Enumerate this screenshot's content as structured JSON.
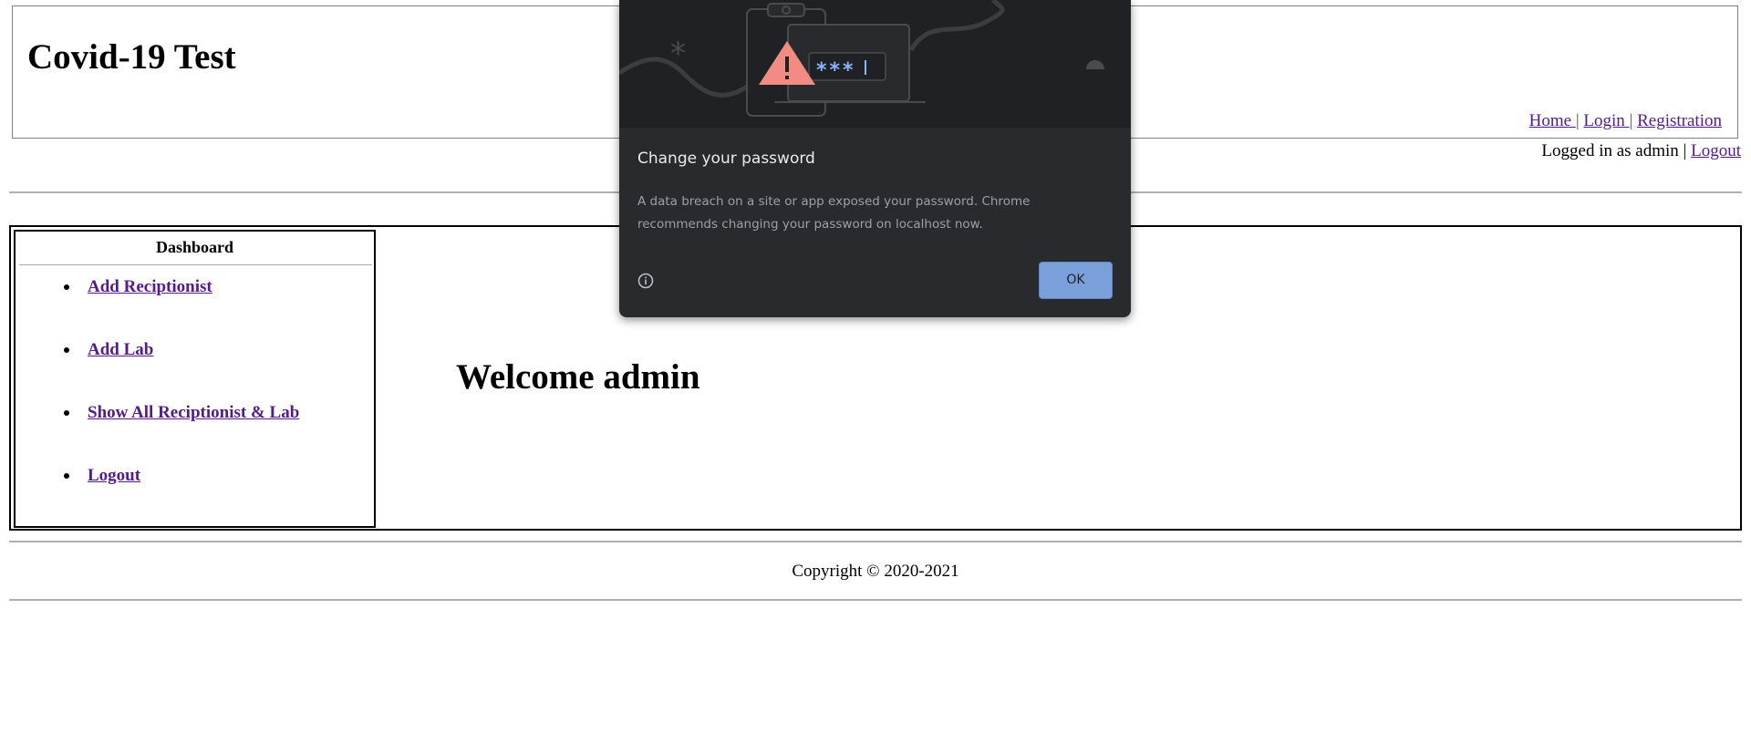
{
  "header": {
    "title": "Covid-19 Test",
    "nav": [
      {
        "label": "Home "
      },
      {
        "label": "Login "
      },
      {
        "label": "Registration"
      }
    ],
    "separator": "|"
  },
  "session": {
    "logged_in_text": "Logged in as admin",
    "separator": "|",
    "logout_label": "Logout"
  },
  "sidebar": {
    "title": "Dashboard",
    "items": [
      {
        "label": "Add Reciptionist"
      },
      {
        "label": "Add Lab"
      },
      {
        "label": "Show All Reciptionist & Lab"
      },
      {
        "label": "Logout"
      }
    ]
  },
  "main": {
    "welcome": "Welcome admin"
  },
  "footer": {
    "copyright": "Copyright © 2020-2021"
  },
  "dialog": {
    "title": "Change your password",
    "body": "A data breach on a site or app exposed your password. Chrome recommends changing your password on localhost now.",
    "ok_label": "OK",
    "art_password_mask": "***",
    "colors": {
      "background": "#292a2d",
      "button": "#7aa0dc",
      "warning": "#f28b82"
    }
  }
}
